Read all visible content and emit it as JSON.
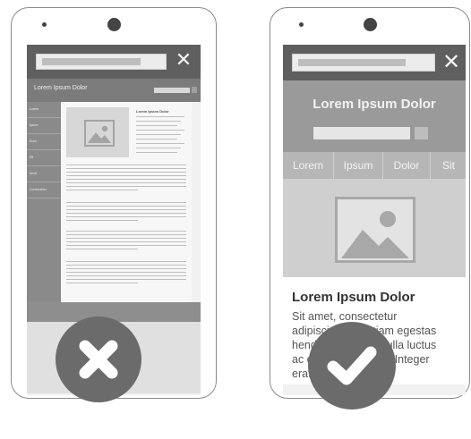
{
  "colors": {
    "badge": "#6b6b6b",
    "frame": "#8a8a8a",
    "topbar": "#5f5f5f"
  },
  "left_phone": {
    "title": "Lorem Ipsum Dolor",
    "sidebar_items": [
      "Lorem",
      "Ipsum",
      "Dolor",
      "Sit",
      "Amet",
      "Consectetur"
    ],
    "article_heading": "Lorem Ipsum Dolor",
    "close_icon": "close-icon",
    "verdict_icon": "cross-icon"
  },
  "right_phone": {
    "title": "Lorem Ipsum Dolor",
    "nav_items": [
      "Lorem",
      "Ipsum",
      "Dolor",
      "Sit"
    ],
    "article_heading": "Lorem Ipsum Dolor",
    "article_text": "Sit amet, consectetur adipiscing elit. Etiam egestas hendrerit cursus. Nulla luctus ac enim ac volutpat. Integer erat",
    "close_icon": "close-icon",
    "verdict_icon": "check-icon"
  }
}
